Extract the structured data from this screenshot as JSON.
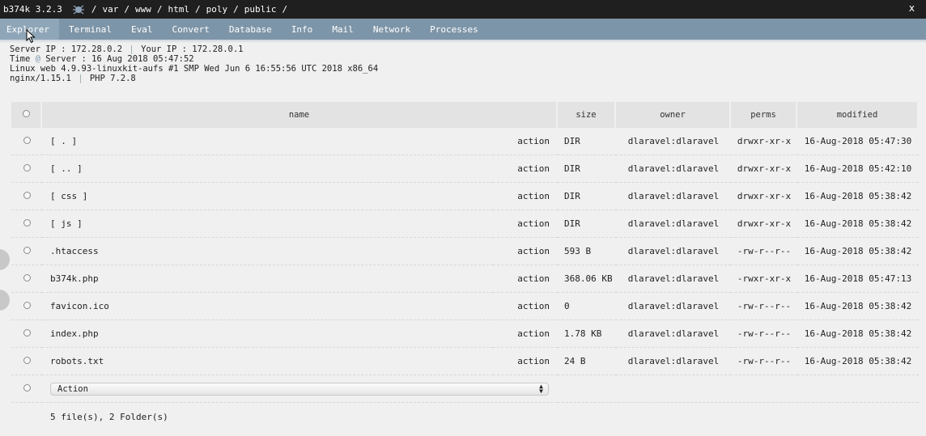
{
  "header": {
    "title": "b374k 3.2.3",
    "logo_icon": "spider-logo-icon",
    "path": [
      "/",
      "var",
      "/",
      "www",
      "/",
      "html",
      "/",
      "poly",
      "/",
      "public",
      "/"
    ],
    "close_label": "x"
  },
  "nav": {
    "tabs": [
      {
        "label": "Explorer",
        "active": true
      },
      {
        "label": "Terminal"
      },
      {
        "label": "Eval"
      },
      {
        "label": "Convert"
      },
      {
        "label": "Database"
      },
      {
        "label": "Info"
      },
      {
        "label": "Mail"
      },
      {
        "label": "Network"
      },
      {
        "label": "Processes"
      }
    ]
  },
  "server_info": {
    "server_ip_label": "Server IP : 172.28.0.2",
    "your_ip_label": "Your IP : 172.28.0.1",
    "time_prefix": "Time",
    "time_at": "@",
    "time_rest": "Server : 16 Aug 2018 05:47:52",
    "uname": "Linux web 4.9.93-linuxkit-aufs #1 SMP Wed Jun 6 16:55:56 UTC 2018 x86_64",
    "software": "nginx/1.15.1",
    "php": "PHP 7.2.8",
    "separator": "|"
  },
  "table": {
    "headers": {
      "name": "name",
      "size": "size",
      "owner": "owner",
      "perms": "perms",
      "modified": "modified"
    },
    "rows": [
      {
        "name": "[ . ]",
        "action": "action",
        "size": "DIR",
        "owner": "dlaravel:dlaravel",
        "perms": "drwxr-xr-x",
        "modified": "16-Aug-2018 05:47:30"
      },
      {
        "name": "[ .. ]",
        "action": "action",
        "size": "DIR",
        "owner": "dlaravel:dlaravel",
        "perms": "drwxr-xr-x",
        "modified": "16-Aug-2018 05:42:10"
      },
      {
        "name": "[ css ]",
        "action": "action",
        "size": "DIR",
        "owner": "dlaravel:dlaravel",
        "perms": "drwxr-xr-x",
        "modified": "16-Aug-2018 05:38:42"
      },
      {
        "name": "[ js ]",
        "action": "action",
        "size": "DIR",
        "owner": "dlaravel:dlaravel",
        "perms": "drwxr-xr-x",
        "modified": "16-Aug-2018 05:38:42"
      },
      {
        "name": ".htaccess",
        "action": "action",
        "size": "593 B",
        "owner": "dlaravel:dlaravel",
        "perms": "-rw-r--r--",
        "modified": "16-Aug-2018 05:38:42"
      },
      {
        "name": "b374k.php",
        "action": "action",
        "size": "368.06 KB",
        "owner": "dlaravel:dlaravel",
        "perms": "-rwxr-xr-x",
        "modified": "16-Aug-2018 05:47:13"
      },
      {
        "name": "favicon.ico",
        "action": "action",
        "size": "0",
        "owner": "dlaravel:dlaravel",
        "perms": "-rw-r--r--",
        "modified": "16-Aug-2018 05:38:42"
      },
      {
        "name": "index.php",
        "action": "action",
        "size": "1.78 KB",
        "owner": "dlaravel:dlaravel",
        "perms": "-rw-r--r--",
        "modified": "16-Aug-2018 05:38:42"
      },
      {
        "name": "robots.txt",
        "action": "action",
        "size": "24 B",
        "owner": "dlaravel:dlaravel",
        "perms": "-rw-r--r--",
        "modified": "16-Aug-2018 05:38:42"
      }
    ],
    "action_select": {
      "value": "Action"
    },
    "summary": "5 file(s), 2 Folder(s)"
  }
}
